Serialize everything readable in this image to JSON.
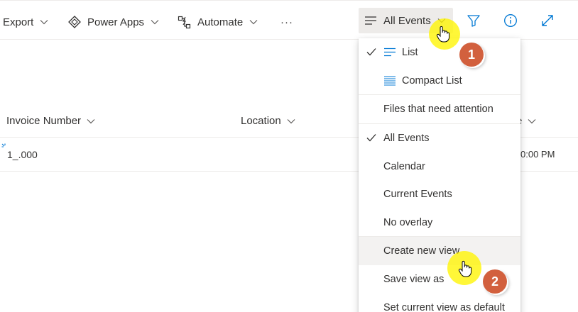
{
  "toolbar": {
    "export_label": "Export",
    "power_apps_label": "Power Apps",
    "automate_label": "Automate",
    "more_label": "···",
    "view_label": "All Events"
  },
  "columns": {
    "invoice_number": "Invoice Number",
    "location": "Location",
    "partial_right": "e"
  },
  "row": {
    "invoice_value": "1_.000",
    "time_partial": "0:00 PM"
  },
  "view_menu": {
    "items": [
      {
        "label": "List",
        "checked": true,
        "icon": "list-view-icon"
      },
      {
        "label": "Compact List",
        "checked": false,
        "icon": "compact-list-icon"
      },
      {
        "label": "Files that need attention",
        "checked": false
      },
      {
        "label": "All Events",
        "checked": true
      },
      {
        "label": "Calendar",
        "checked": false
      },
      {
        "label": "Current Events",
        "checked": false
      },
      {
        "label": "No overlay",
        "checked": false
      },
      {
        "label": "Create new view",
        "checked": false,
        "hovered": true
      },
      {
        "label": "Save view as",
        "checked": false
      },
      {
        "label": "Set current view as default",
        "checked": false
      }
    ]
  },
  "annotations": {
    "step1": "1",
    "step2": "2"
  },
  "colors": {
    "accent": "#0078d4",
    "badge": "#d2603e",
    "highlight": "#fff500",
    "hover_bg": "#f3f2f1"
  }
}
